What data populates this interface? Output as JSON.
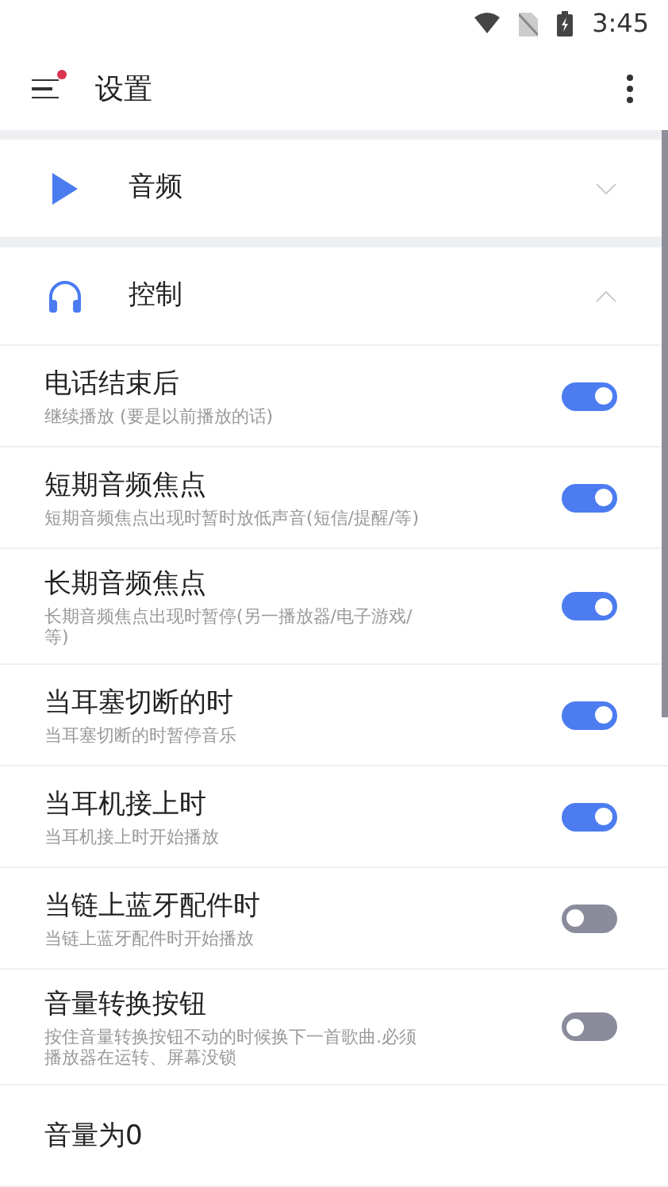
{
  "status_bar": {
    "time": "3:45"
  },
  "app_bar": {
    "title": "设置",
    "menu_badge": true
  },
  "sections": [
    {
      "kind": "play",
      "title": "音频",
      "expanded": false
    },
    {
      "kind": "headphones",
      "title": "控制",
      "expanded": true
    }
  ],
  "settings": [
    {
      "title": "电话结束后",
      "subtitle": "继续播放 (要是以前播放的话)",
      "on": true
    },
    {
      "title": "短期音频焦点",
      "subtitle": "短期音频焦点出现时暂时放低声音(短信/提醒/等)",
      "on": true
    },
    {
      "title": "长期音频焦点",
      "subtitle": "长期音频焦点出现时暂停(另一播放器/电子游戏/等)",
      "on": true
    },
    {
      "title": "当耳塞切断的时",
      "subtitle": "当耳塞切断的时暂停音乐",
      "on": true
    },
    {
      "title": "当耳机接上时",
      "subtitle": "当耳机接上时开始播放",
      "on": true
    },
    {
      "title": "当链上蓝牙配件时",
      "subtitle": "当链上蓝牙配件时开始播放",
      "on": false
    },
    {
      "title": "音量转换按钮",
      "subtitle": "按住音量转换按钮不动的时候换下一首歌曲.必须播放器在运转、屏幕没锁",
      "on": false
    },
    {
      "title": "音量为0"
    }
  ]
}
